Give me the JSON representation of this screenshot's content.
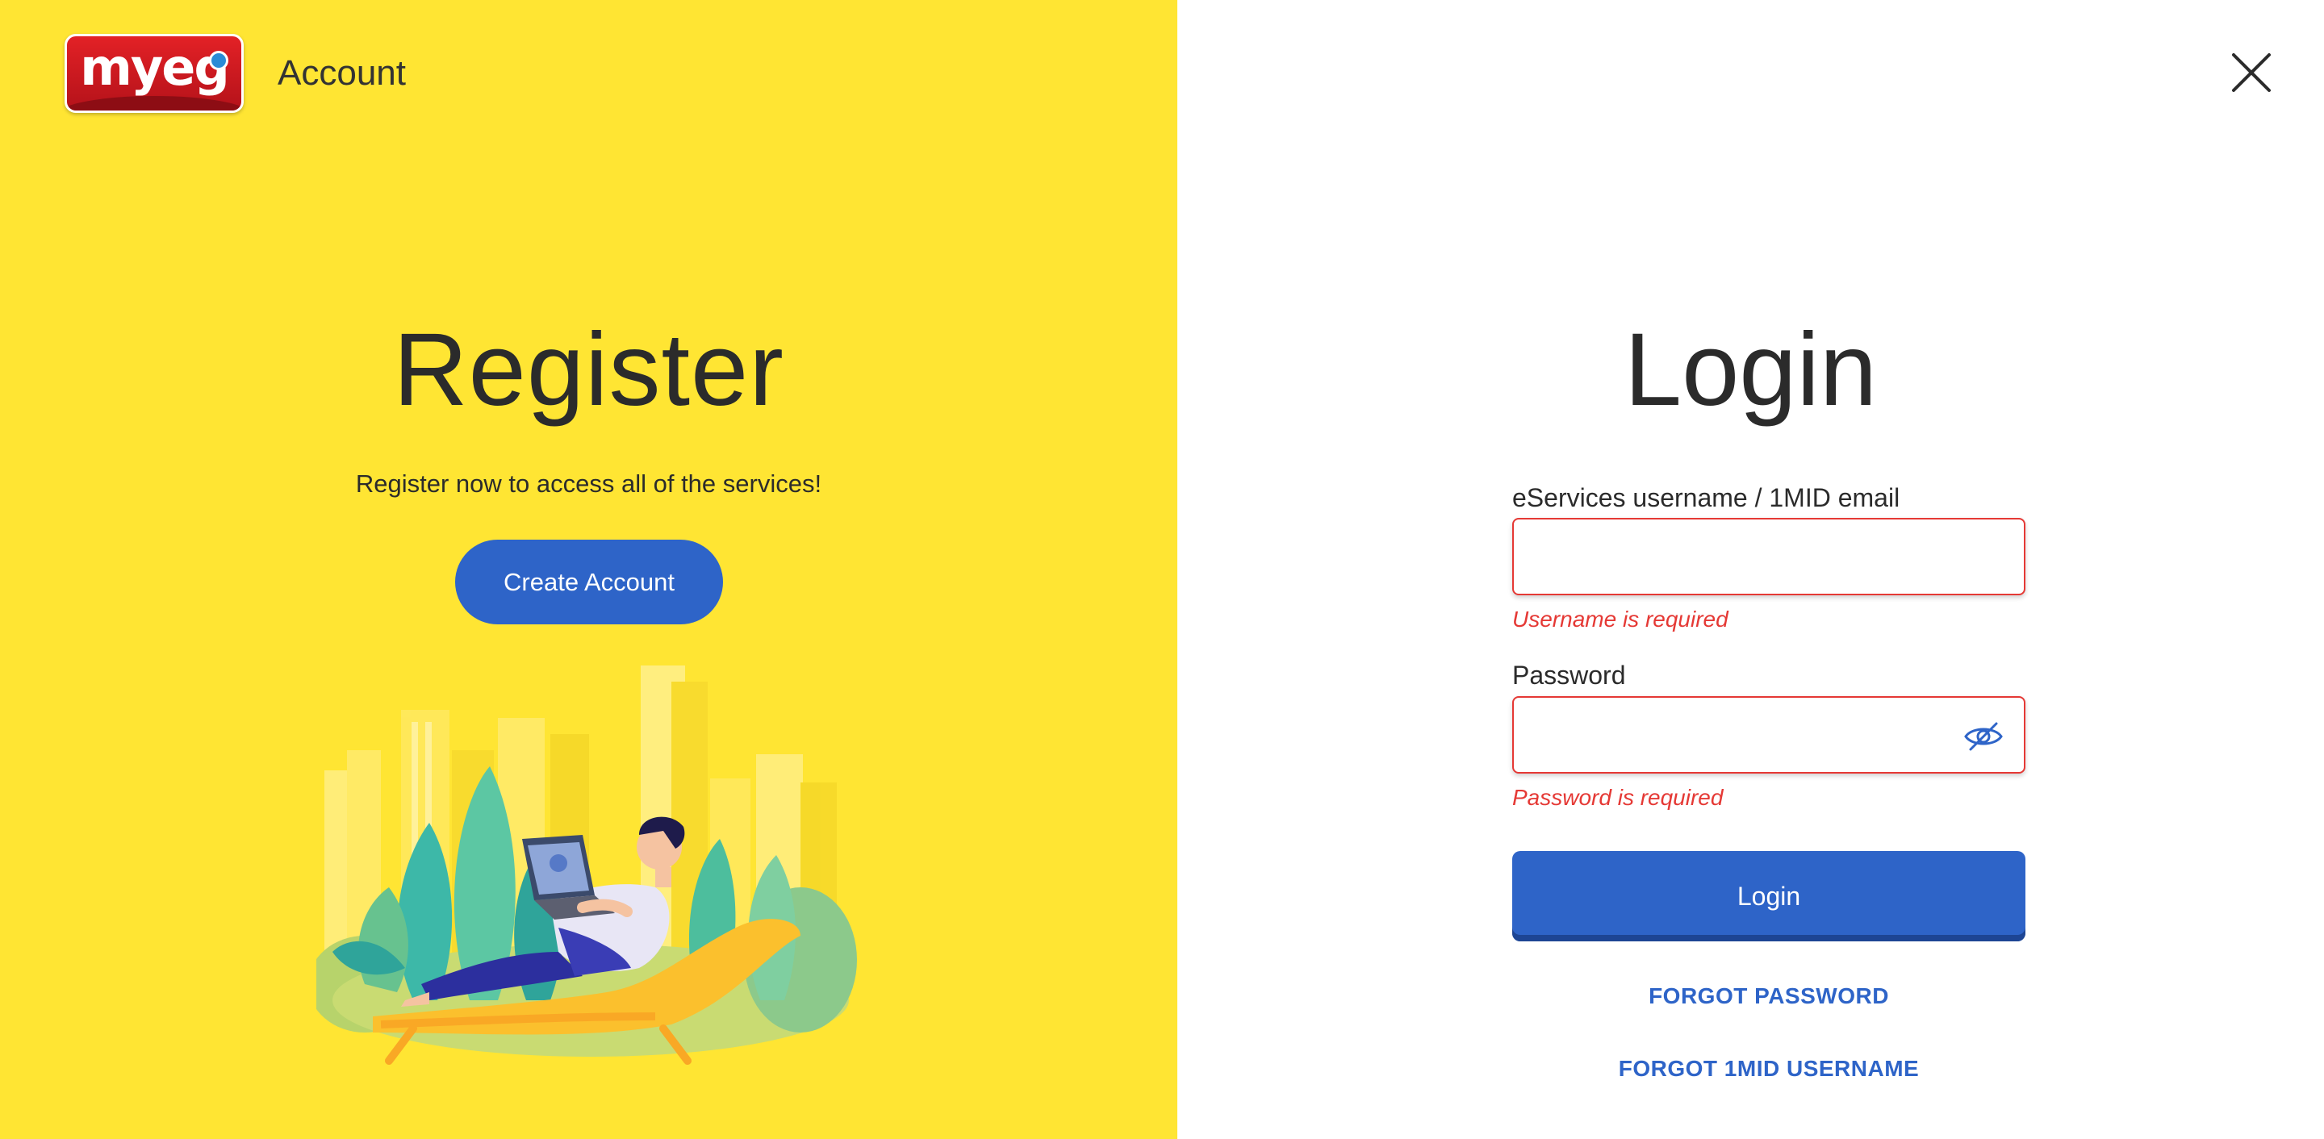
{
  "brand": {
    "logo_text": "myeg",
    "title": "Account"
  },
  "register": {
    "title": "Register",
    "subtitle": "Register now to access all of the services!",
    "create_button": "Create Account"
  },
  "login": {
    "title": "Login",
    "username": {
      "label": "eServices username / 1MID email",
      "value": "",
      "error": "Username is required"
    },
    "password": {
      "label": "Password",
      "value": "",
      "error": "Password is required"
    },
    "submit_label": "Login",
    "forgot_password": "FORGOT PASSWORD",
    "forgot_username": "FORGOT 1MID USERNAME"
  },
  "icons": {
    "close": "close-icon",
    "password_toggle": "eye-off-icon"
  },
  "colors": {
    "left_background": "#FFE533",
    "primary": "#2E64C8",
    "error": "#E53935",
    "logo_red": "#E32126"
  }
}
